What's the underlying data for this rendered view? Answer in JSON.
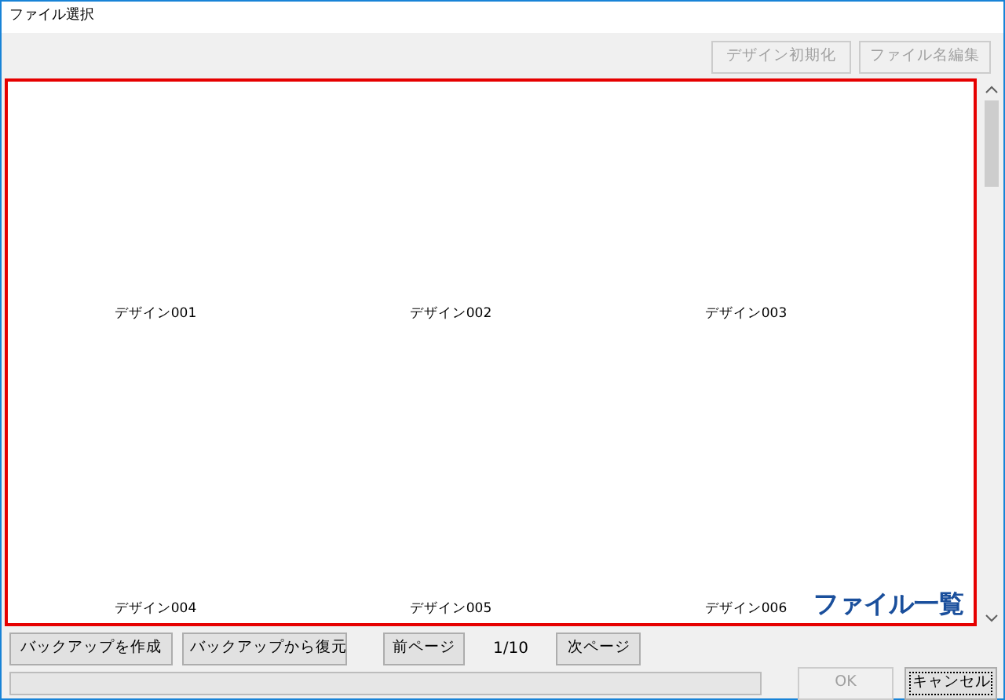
{
  "window": {
    "title": "ファイル選択"
  },
  "top_buttons": [
    {
      "label": "デザイン初期化",
      "disabled": true
    },
    {
      "label": "ファイル名編集",
      "disabled": true
    }
  ],
  "file_list": {
    "items": [
      {
        "label": "デザイン001"
      },
      {
        "label": "デザイン002"
      },
      {
        "label": "デザイン003"
      },
      {
        "label": "デザイン004"
      },
      {
        "label": "デザイン005"
      },
      {
        "label": "デザイン006"
      }
    ],
    "annotation": "ファイル一覧"
  },
  "backup_buttons": [
    {
      "label": "バックアップを作成"
    },
    {
      "label": "バックアップから復元"
    }
  ],
  "pager": {
    "prev": "前ページ",
    "page": "1/10",
    "next": "次ページ"
  },
  "progress": {
    "level": 0
  },
  "dialog_buttons": [
    {
      "label": "OK",
      "disabled": true,
      "focused": false
    },
    {
      "label": "キャンセル",
      "disabled": false,
      "focused": true
    }
  ]
}
